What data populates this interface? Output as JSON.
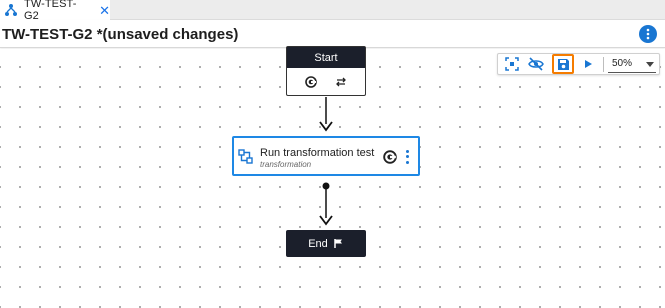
{
  "tab": {
    "label": "TW-TEST-G2",
    "close": "✕"
  },
  "header": {
    "title": "TW-TEST-G2 *(unsaved changes)"
  },
  "toolbar": {
    "zoom_value": "50%"
  },
  "nodes": {
    "start_label": "Start",
    "task_title": "Run transformation test",
    "task_subtitle": "transformation",
    "end_label": "End"
  },
  "colors": {
    "accent": "#1976d2",
    "highlight": "#f57c00",
    "node_dark": "#1b1f2b"
  },
  "icons": [
    "workflow-icon",
    "close-icon",
    "more-vert-icon",
    "fit-screen-icon",
    "visibility-off-icon",
    "save-icon",
    "play-icon",
    "chevron-down-icon",
    "c-badge-icon",
    "repeat-icon",
    "task-icon",
    "flag-icon"
  ]
}
